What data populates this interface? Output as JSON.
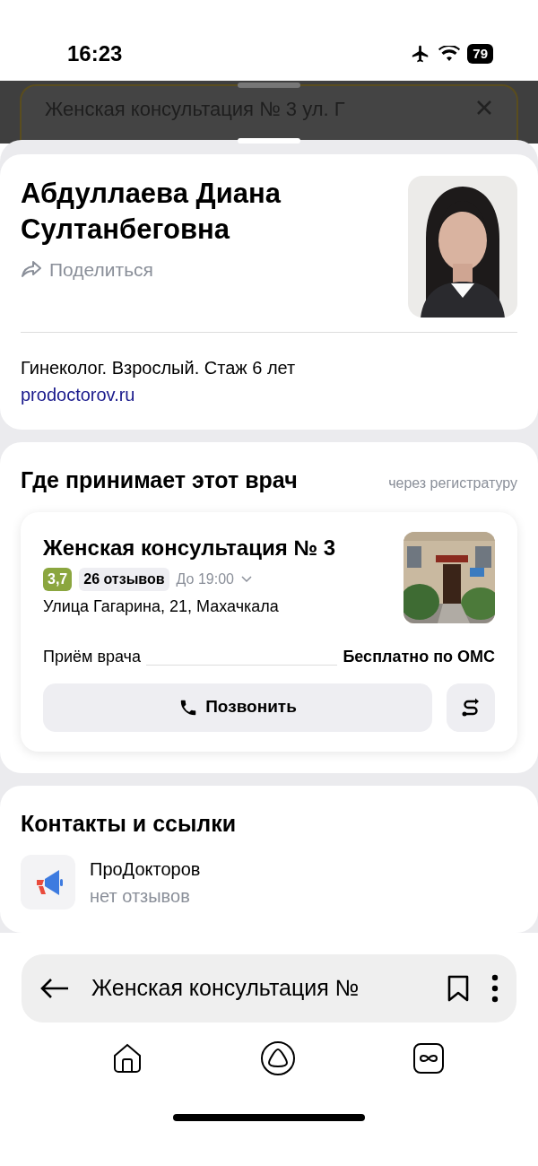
{
  "status_bar": {
    "time": "16:23",
    "battery": "79"
  },
  "background_search": {
    "text": "Женская консультация № 3 ул. Г"
  },
  "doctor": {
    "name": "Абдуллаева Диана Султанбеговна",
    "share": "Поделиться",
    "description": "Гинеколог. Взрослый. Стаж 6 лет",
    "source_link": "prodoctorov.ru"
  },
  "workplaces": {
    "title": "Где принимает этот врач",
    "note": "через регистратуру",
    "clinics": [
      {
        "name": "Женская консультация № 3",
        "rating": "3,7",
        "reviews": "26 отзывов",
        "hours": "До 19:00",
        "address": "Улица Гагарина, 21, Махачкала",
        "service": "Приём врача",
        "price": "Бесплатно по ОМС",
        "call_button": "Позвонить"
      }
    ]
  },
  "contacts": {
    "title": "Контакты и ссылки",
    "items": [
      {
        "name": "ПроДокторов",
        "subtitle": "нет отзывов"
      }
    ]
  },
  "address_bar": {
    "text": "Женская консультация №"
  }
}
